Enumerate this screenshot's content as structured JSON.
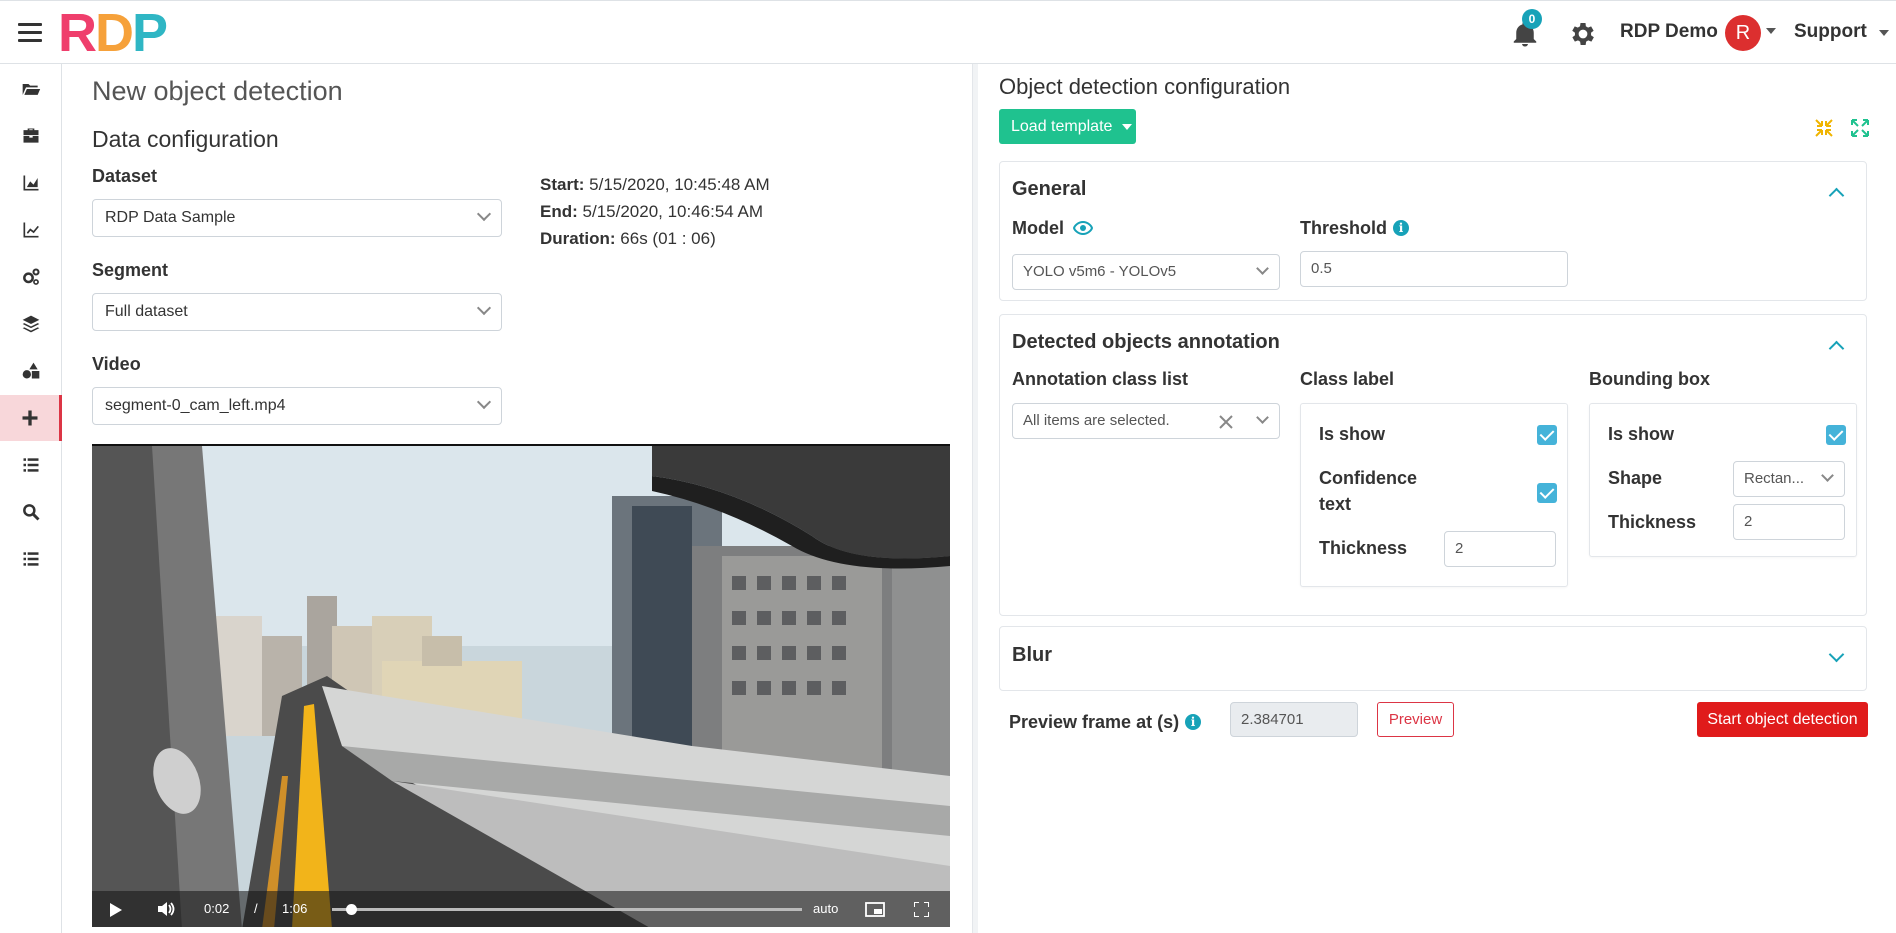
{
  "header": {
    "logo_r": "R",
    "logo_d": "D",
    "logo_p": "P",
    "notification_count": "0",
    "user_name": "RDP Demo",
    "avatar_initial": "R",
    "support_label": "Support"
  },
  "sidebar": {
    "items": [
      {
        "icon": "folder-open-icon"
      },
      {
        "icon": "toolbox-icon"
      },
      {
        "icon": "area-chart-icon"
      },
      {
        "icon": "line-chart-icon"
      },
      {
        "icon": "cogs-icon"
      },
      {
        "icon": "layers-icon"
      },
      {
        "icon": "shapes-icon"
      },
      {
        "icon": "plus-icon",
        "active": true
      },
      {
        "icon": "list-icon"
      },
      {
        "icon": "search-icon"
      },
      {
        "icon": "list-alt-icon"
      }
    ]
  },
  "left": {
    "page_title": "New object detection",
    "section_title": "Data configuration",
    "dataset_label": "Dataset",
    "dataset_value": "RDP Data Sample",
    "segment_label": "Segment",
    "segment_value": "Full dataset",
    "video_label": "Video",
    "video_value": "segment-0_cam_left.mp4",
    "start_label": "Start:",
    "start_value": "5/15/2020, 10:45:48 AM",
    "end_label": "End:",
    "end_value": "5/15/2020, 10:46:54 AM",
    "duration_label": "Duration:",
    "duration_value": "66s (01 : 06)",
    "video_player": {
      "current_time": "0:02",
      "separator": "/",
      "total_time": "1:06",
      "quality": "auto",
      "progress": 0.03
    }
  },
  "right": {
    "title": "Object detection configuration",
    "load_template_label": "Load template",
    "general": {
      "title": "General",
      "model_label": "Model",
      "model_value": "YOLO v5m6 - YOLOv5",
      "threshold_label": "Threshold",
      "threshold_value": "0.5"
    },
    "annotation": {
      "title": "Detected objects annotation",
      "class_list_label": "Annotation class list",
      "class_list_value": "All items are selected.",
      "class_label_title": "Class label",
      "class_is_show_label": "Is show",
      "confidence_label_1": "Confidence",
      "confidence_label_2": "text",
      "class_thickness_label": "Thickness",
      "class_thickness_value": "2",
      "bbox_title": "Bounding box",
      "bbox_is_show_label": "Is show",
      "shape_label": "Shape",
      "shape_value": "Rectan...",
      "bbox_thickness_label": "Thickness",
      "bbox_thickness_value": "2"
    },
    "blur": {
      "title": "Blur"
    },
    "preview_label": "Preview frame at (s)",
    "preview_value": "2.384701",
    "preview_button": "Preview",
    "start_button": "Start object detection"
  },
  "colors": {
    "accent_green": "#1fc28f",
    "accent_red": "#e01b1b",
    "accent_teal": "#17a2b8",
    "checkbox_blue": "#45b3d9"
  }
}
